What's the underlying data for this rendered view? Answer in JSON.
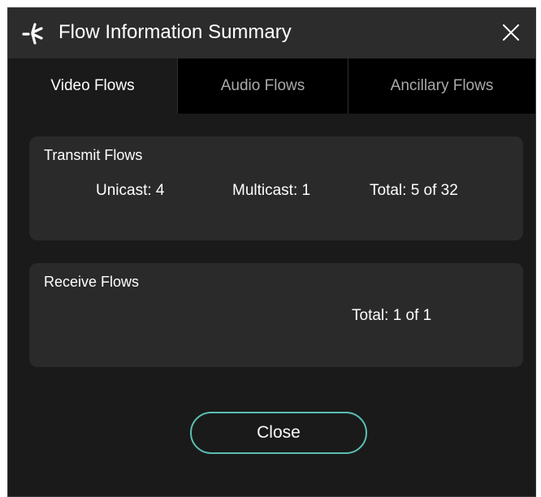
{
  "dialog": {
    "title": "Flow Information Summary",
    "icons": {
      "app": "star-burst-icon",
      "close": "close-icon"
    }
  },
  "tabs": [
    {
      "label": "Video Flows",
      "active": true
    },
    {
      "label": "Audio Flows",
      "active": false
    },
    {
      "label": "Ancillary Flows",
      "active": false
    }
  ],
  "transmit": {
    "title": "Transmit Flows",
    "unicast": "Unicast: 4",
    "multicast": "Multicast: 1",
    "total": "Total: 5 of 32"
  },
  "receive": {
    "title": "Receive Flows",
    "total": "Total: 1 of 1"
  },
  "close_button": {
    "label": "Close"
  },
  "colors": {
    "background": "#1a1a1a",
    "titlebar": "#2c2c2c",
    "tabbar": "#000000",
    "panel": "#2a2a2a",
    "accent": "#5bbfb3"
  }
}
